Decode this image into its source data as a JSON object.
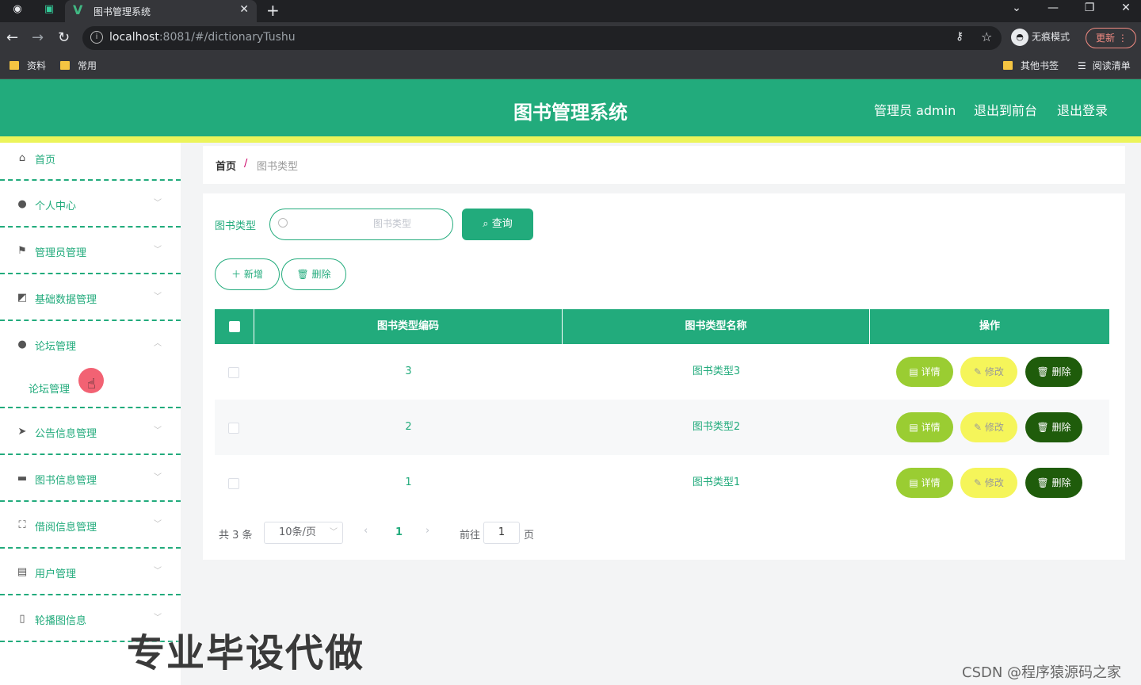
{
  "browser": {
    "tab_title": "图书管理系统",
    "url_host": "localhost",
    "url_rest": ":8081/#/dictionaryTushu",
    "incognito_label": "无痕模式",
    "update_label": "更新",
    "bookmarks": [
      "资料",
      "常用"
    ],
    "bookmarks_right": [
      "其他书签",
      "阅读清单"
    ]
  },
  "header": {
    "title": "图书管理系统",
    "admin_label": "管理员 admin",
    "to_front_label": "退出到前台",
    "logout_label": "退出登录",
    "bg_color": "#22ab7c",
    "accent_color": "#ecf45a"
  },
  "sidebar": {
    "items": [
      {
        "label": "首页",
        "icon": "home-icon"
      },
      {
        "label": "个人中心",
        "icon": "user-icon"
      },
      {
        "label": "管理员管理",
        "icon": "flag-icon"
      },
      {
        "label": "基础数据管理",
        "icon": "chart-icon"
      },
      {
        "label": "论坛管理",
        "icon": "user-icon"
      },
      {
        "label": "公告信息管理",
        "icon": "send-icon"
      },
      {
        "label": "图书信息管理",
        "icon": "briefcase-icon"
      },
      {
        "label": "借阅信息管理",
        "icon": "fullscreen-icon"
      },
      {
        "label": "用户管理",
        "icon": "document-icon"
      },
      {
        "label": "轮播图信息",
        "icon": "phone-icon"
      }
    ],
    "submenu_label": "论坛管理"
  },
  "breadcrumb": {
    "home": "首页",
    "separator": "/",
    "current": "图书类型"
  },
  "search": {
    "label": "图书类型",
    "placeholder": "图书类型",
    "query_label": "查询"
  },
  "actions": {
    "add_label": "新增",
    "delete_label": "删除"
  },
  "table": {
    "columns": [
      "图书类型编码",
      "图书类型名称",
      "操作"
    ],
    "rows": [
      {
        "code": "3",
        "name": "图书类型3"
      },
      {
        "code": "2",
        "name": "图书类型2"
      },
      {
        "code": "1",
        "name": "图书类型1"
      }
    ],
    "row_actions": {
      "detail": "详情",
      "edit": "修改",
      "delete": "删除"
    }
  },
  "pagination": {
    "total": "共 3 条",
    "page_size": "10条/页",
    "current_page": "1",
    "goto_label": "前往",
    "goto_value": "1",
    "page_suffix": "页"
  },
  "overlay": {
    "text": "专业毕设代做",
    "watermark": "CSDN @程序猿源码之家"
  }
}
